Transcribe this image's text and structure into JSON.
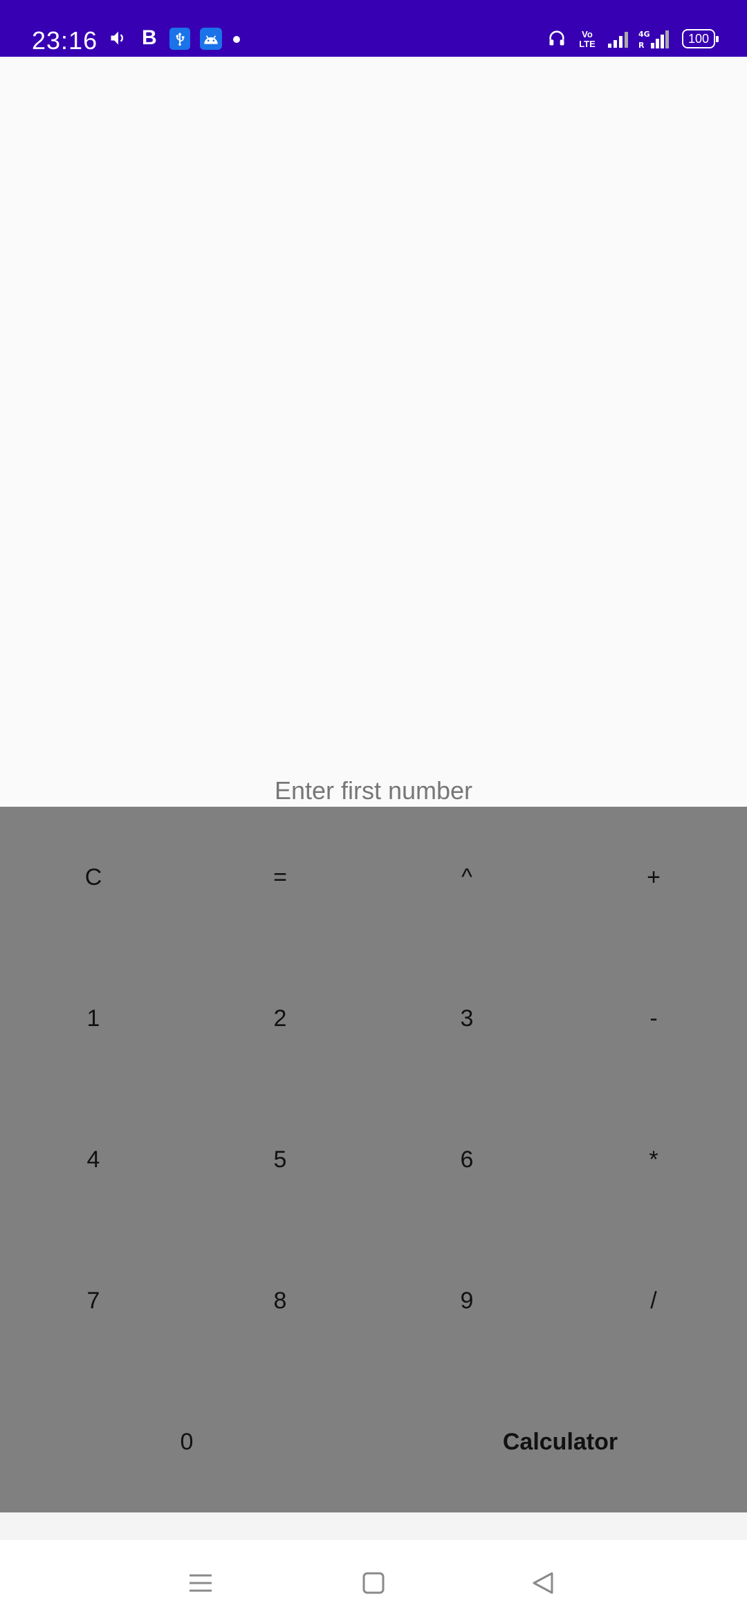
{
  "status_bar": {
    "time": "23:16",
    "bluetooth_letter": "B",
    "network_volte": [
      "Vo",
      "LTE"
    ],
    "network_gen": "4G",
    "battery": "100",
    "icons": [
      "volume-icon",
      "bold-b-icon",
      "usb-icon",
      "android-icon",
      "dot-icon",
      "headphones-icon",
      "volte-icon",
      "signal-icon",
      "4g-signal-icon",
      "battery-icon"
    ],
    "bg_color": "#3700b3"
  },
  "display": {
    "placeholder": "Enter first number",
    "value": ""
  },
  "keypad": {
    "bg_color": "#808080",
    "rows": [
      [
        "C",
        "=",
        "^",
        "+"
      ],
      [
        "1",
        "2",
        "3",
        "-"
      ],
      [
        "4",
        "5",
        "6",
        "*"
      ],
      [
        "7",
        "8",
        "9",
        "/"
      ]
    ],
    "bottom": {
      "zero": "0",
      "title": "Calculator"
    }
  },
  "nav_bar": {
    "buttons": [
      "menu-icon",
      "home-icon",
      "back-icon"
    ]
  }
}
